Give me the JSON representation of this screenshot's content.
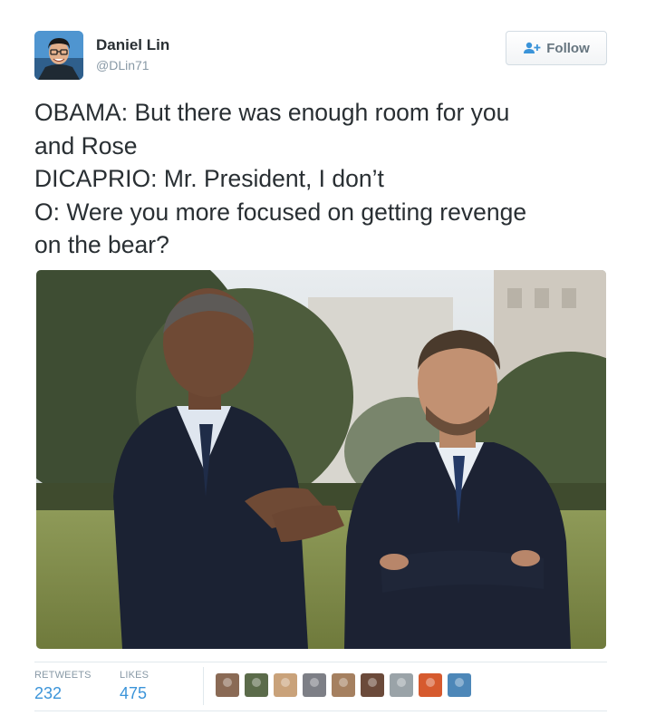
{
  "user": {
    "display_name": "Daniel Lin",
    "handle": "@DLin71"
  },
  "follow_button": {
    "label": "Follow",
    "icon": "follow-person-plus-icon"
  },
  "tweet_text": [
    "OBAMA: But there was enough room for you",
    "and Rose",
    "DICAPRIO: Mr. President, I don’t",
    "O: Were you more focused on getting revenge",
    "on the bear?"
  ],
  "stats": {
    "retweets_label": "RETWEETS",
    "retweets_value": "232",
    "likes_label": "LIKES",
    "likes_value": "475"
  },
  "likers": [
    {
      "color": "#8a6a55"
    },
    {
      "color": "#5b6b4a"
    },
    {
      "color": "#c9a27a"
    },
    {
      "color": "#7d7f86"
    },
    {
      "color": "#a58060"
    },
    {
      "color": "#6b4a3a"
    },
    {
      "color": "#9aa3a8"
    },
    {
      "color": "#d65a2e"
    },
    {
      "color": "#4d87b8"
    }
  ],
  "colors": {
    "accent": "#3b94d9",
    "text": "#292f33",
    "muted": "#8899a6"
  }
}
